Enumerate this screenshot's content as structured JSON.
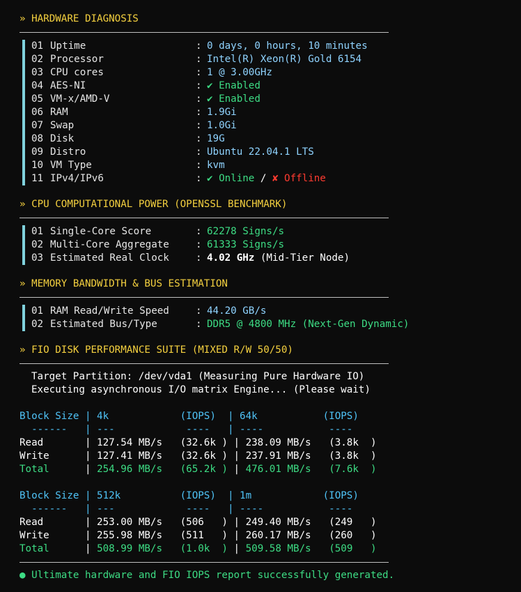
{
  "sections": {
    "hw": "» HARDWARE DIAGNOSIS",
    "cpu": "» CPU COMPUTATIONAL POWER (OPENSSL BENCHMARK)",
    "mem": "» MEMORY BANDWIDTH & BUS ESTIMATION",
    "fio": "» FIO DISK PERFORMANCE SUITE (MIXED R/W 50/50)"
  },
  "hardware": [
    {
      "idx": "01",
      "key": "Uptime",
      "val": "0 days, 0 hours, 10 minutes"
    },
    {
      "idx": "02",
      "key": "Processor",
      "val": "Intel(R) Xeon(R) Gold 6154"
    },
    {
      "idx": "03",
      "key": "CPU cores",
      "val": "1 @ 3.00GHz"
    },
    {
      "idx": "04",
      "key": "AES-NI",
      "val": "✔ Enabled"
    },
    {
      "idx": "05",
      "key": "VM-x/AMD-V",
      "val": "✔ Enabled"
    },
    {
      "idx": "06",
      "key": "RAM",
      "val": "1.9Gi"
    },
    {
      "idx": "07",
      "key": "Swap",
      "val": "1.0Gi"
    },
    {
      "idx": "08",
      "key": "Disk",
      "val": "19G"
    },
    {
      "idx": "09",
      "key": "Distro",
      "val": "Ubuntu 22.04.1 LTS"
    },
    {
      "idx": "10",
      "key": "VM Type",
      "val": "kvm"
    },
    {
      "idx": "11",
      "key": "IPv4/IPv6",
      "online": "✔ Online",
      "sep": " / ",
      "offline": "✘ Offline"
    }
  ],
  "cpu": [
    {
      "idx": "01",
      "key": "Single-Core Score",
      "val": "62278 Signs/s"
    },
    {
      "idx": "02",
      "key": "Multi-Core Aggregate",
      "val": "61333 Signs/s"
    },
    {
      "idx": "03",
      "key": "Estimated Real Clock",
      "val": "4.02 GHz",
      "val2": " (Mid-Tier Node)"
    }
  ],
  "memory": [
    {
      "idx": "01",
      "key": "RAM Read/Write Speed",
      "val": "44.20 GB/s"
    },
    {
      "idx": "02",
      "key": "Estimated Bus/Type",
      "val": "DDR5 @ 4800 MHz (Next-Gen Dynamic)"
    }
  ],
  "fio": {
    "partition": "Target Partition: /dev/vda1 (Measuring Pure Hardware IO)",
    "executing": "Executing asynchronous I/O matrix Engine... (Please wait)",
    "tables": [
      {
        "header": "Block Size | 4k            (IOPS)  | 64k           (IOPS)",
        "dash": "  ------   | ---            ----   | ----           ----",
        "read": "Read       | 127.54 MB/s   (32.6k ) | 238.09 MB/s   (3.8k  )",
        "write": "Write      | 127.41 MB/s   (32.6k ) | 237.91 MB/s   (3.8k  )",
        "total_label": "Total",
        "total_pre": "      | ",
        "total_v1": "254.96 MB/s   (65.2k )",
        "total_mid": " | ",
        "total_v2": "476.01 MB/s   (7.6k  )"
      },
      {
        "header": "Block Size | 512k          (IOPS)  | 1m            (IOPS)",
        "dash": "  ------   | ---            ----   | ----           ----",
        "read": "Read       | 253.00 MB/s   (506   ) | 249.40 MB/s   (249   )",
        "write": "Write      | 255.98 MB/s   (511   ) | 260.17 MB/s   (260   )",
        "total_label": "Total",
        "total_pre": "      | ",
        "total_v1": "508.99 MB/s   (1.0k  )",
        "total_mid": " | ",
        "total_v2": "509.58 MB/s   (509   )"
      }
    ]
  },
  "footer": "● Ultimate hardware and FIO IOPS report successfully generated.",
  "colors": {
    "header": "#f4d03f",
    "value": "#8fd3ff",
    "ok": "#3ddc84",
    "bad": "#ff3b30",
    "accent_bar": "#7fd1dc"
  }
}
